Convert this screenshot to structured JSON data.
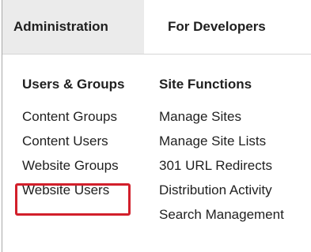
{
  "tabs": [
    {
      "label": "Administration",
      "active": true
    },
    {
      "label": "For Developers",
      "active": false
    }
  ],
  "columns": {
    "left": {
      "heading": "Users & Groups",
      "items": [
        "Content Groups",
        "Content Users",
        "Website Groups",
        "Website Users"
      ]
    },
    "right": {
      "heading": "Site Functions",
      "items": [
        "Manage Sites",
        "Manage Site Lists",
        "301 URL Redirects",
        "Distribution Activity",
        "Search Management"
      ]
    }
  },
  "highlight": {
    "target": "Website Users",
    "color": "#d21f2b"
  },
  "colors": {
    "active_tab_bg": "#ebebeb",
    "text": "#1f1f1f",
    "border": "#a9a9a9"
  }
}
